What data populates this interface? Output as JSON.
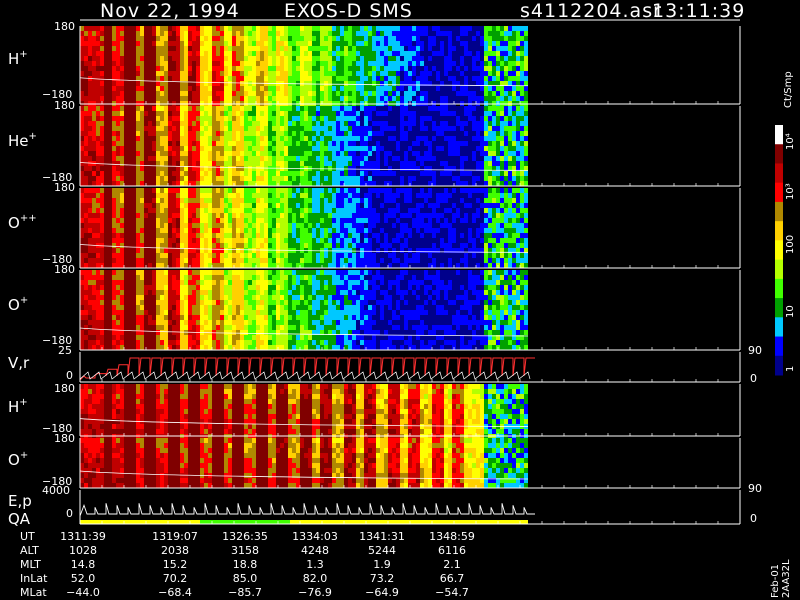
{
  "header": {
    "date": "Nov 22, 1994",
    "instrument": "EXOS-D SMS",
    "file": "s4112204.asr",
    "time": "13:11:39"
  },
  "colorbar": {
    "unit": "Ct/Smp",
    "ticks": [
      "10⁴",
      "10³",
      "100",
      "10",
      "1"
    ],
    "colors": [
      "#000066",
      "#00008b",
      "#0000ff",
      "#00c8ff",
      "#00a000",
      "#40ff00",
      "#b4ff00",
      "#ffff00",
      "#ffd000",
      "#b08800",
      "#ff0000",
      "#c00000",
      "#800000",
      "#ffffff"
    ]
  },
  "footer_note": "Feb-01 2AA32L",
  "chart_data": {
    "type": "heatmap",
    "panels": [
      {
        "id": "h-plus-1",
        "label": "H",
        "sup": "+",
        "ymax": "180",
        "ymin": "−180",
        "decay": 0.85,
        "mid": 0.74
      },
      {
        "id": "he-plus",
        "label": "He",
        "sup": "+",
        "ymax": "180",
        "ymin": "−180",
        "decay": 1.0,
        "mid": 0.78
      },
      {
        "id": "o-plus-plus",
        "label": "O",
        "sup": "++",
        "ymax": "180",
        "ymin": "−180",
        "decay": 1.0,
        "mid": 0.78
      },
      {
        "id": "o-plus-1",
        "label": "O",
        "sup": "+",
        "ymax": "180",
        "ymin": "−180",
        "decay": 1.0,
        "mid": 0.8
      },
      {
        "id": "v-r",
        "label": "V,r",
        "sup": "",
        "ymax": "25",
        "ymin": "0",
        "right_top": "90",
        "right_bottom": "0"
      },
      {
        "id": "h-plus-2",
        "label": "H",
        "sup": "+",
        "ymax": "180",
        "ymin": "−180",
        "decay": 0.3,
        "mid": 0.78
      },
      {
        "id": "o-plus-2",
        "label": "O",
        "sup": "+",
        "ymax": "180",
        "ymin": "−180",
        "decay": 0.3,
        "mid": 0.78
      },
      {
        "id": "e-p-qa",
        "label": "E,p",
        "label2": "QA",
        "sup": "",
        "ymax": "4000",
        "ymin": "0",
        "right_top": "90",
        "right_bottom": "0"
      }
    ],
    "footer_labels": [
      "UT",
      "ALT",
      "MLT",
      "InLat",
      "MLat"
    ],
    "footer_columns": [
      {
        "UT": "1311:39",
        "ALT": "1028",
        "MLT": "14.8",
        "InLat": "52.0",
        "MLat": "−44.0"
      },
      {
        "UT": "1319:07",
        "ALT": "2038",
        "MLT": "15.2",
        "InLat": "70.2",
        "MLat": "−68.4"
      },
      {
        "UT": "1326:35",
        "ALT": "3158",
        "MLT": "18.8",
        "InLat": "85.0",
        "MLat": "−85.7"
      },
      {
        "UT": "1334:03",
        "ALT": "4248",
        "MLT": "1.3",
        "InLat": "82.0",
        "MLat": "−76.9"
      },
      {
        "UT": "1341:31",
        "ALT": "5244",
        "MLT": "1.9",
        "InLat": "73.2",
        "MLat": "−64.9"
      },
      {
        "UT": "1348:59",
        "ALT": "6116",
        "MLT": "2.1",
        "InLat": "66.7",
        "MLat": "−54.7"
      }
    ]
  }
}
